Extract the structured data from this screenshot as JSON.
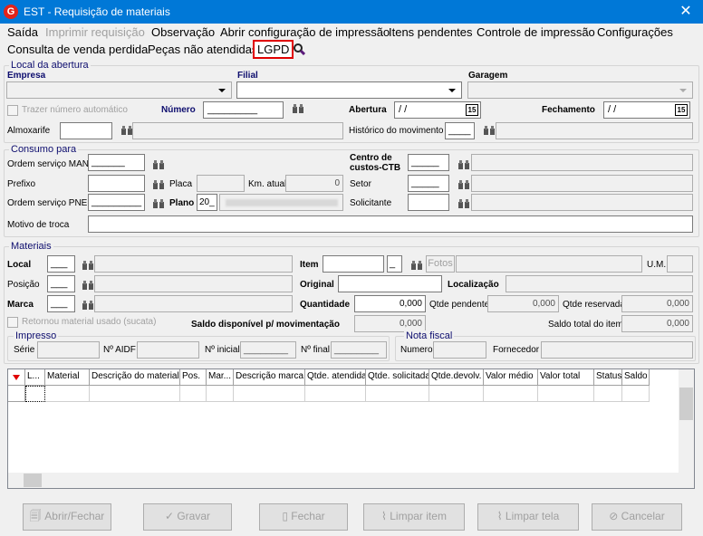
{
  "window": {
    "title": "EST - Requisição de materiais",
    "close": "✕",
    "logo": "G"
  },
  "menu": {
    "saida": "Saída",
    "imprimir": "Imprimir requisição",
    "observacao": "Observação",
    "abrir_config": "Abrir configuração de impressão",
    "itens_pendentes": "Itens pendentes",
    "controle": "Controle de impressão",
    "configuracoes": "Configurações",
    "consulta": "Consulta de venda perdida",
    "pecas": "Peças não atendidas",
    "lgpd": "LGPD"
  },
  "local": {
    "group": "Local da abertura",
    "empresa": "Empresa",
    "filial": "Filial",
    "garagem": "Garagem",
    "trazer": "Trazer número automático",
    "numero": "Número",
    "numero_value": "_________",
    "abertura": "Abertura",
    "abertura_value": "/ /",
    "fechamento": "Fechamento",
    "fechamento_value": "/ /",
    "cal": "15",
    "almoxarife": "Almoxarife",
    "historico": "Histórico do movimento",
    "historico_value": "____"
  },
  "consumo": {
    "group": "Consumo para",
    "os_man": "Ordem serviço MAN",
    "os_man_value": "______",
    "centro": "Centro de custos-CTB",
    "centro_value": "_____",
    "prefixo": "Prefixo",
    "placa": "Placa",
    "km": "Km. atual",
    "km_value": "0",
    "setor": "Setor",
    "setor_value": "_____",
    "os_pne": "Ordem serviço PNE",
    "os_pne_value": "_________",
    "plano": "Plano",
    "plano_value": "20_",
    "solicitante": "Solicitante",
    "motivo": "Motivo de troca"
  },
  "materiais": {
    "group": "Materiais",
    "local": "Local",
    "local_value": "___",
    "item": "Item",
    "item_suffix": "_",
    "fotos": "Fotos",
    "um": "U.M.",
    "posicao": "Posição",
    "posicao_value": "___",
    "original": "Original",
    "localizacao": "Localização",
    "marca": "Marca",
    "marca_value": "___",
    "quantidade": "Quantidade",
    "quantidade_value": "0,000",
    "qtde_pendente": "Qtde pendente",
    "qtde_pendente_value": "0,000",
    "qtde_reservada": "Qtde reservada",
    "qtde_reservada_value": "0,000",
    "retornou": "Retornou material usado (sucata)",
    "saldo_disp": "Saldo disponível p/ movimentação",
    "saldo_disp_value": "0,000",
    "saldo_total": "Saldo total do item",
    "saldo_total_value": "0,000"
  },
  "impresso": {
    "group": "Impresso",
    "serie": "Série",
    "aidf": "Nº AIDF",
    "inicial": "Nº inicial",
    "inicial_value": "________",
    "final": "Nº final",
    "final_value": "________"
  },
  "nota": {
    "group": "Nota fiscal",
    "numero": "Numero",
    "fornecedor": "Fornecedor"
  },
  "grid": {
    "columns": [
      "L...",
      "Material",
      "Descrição do material",
      "Pos.",
      "Mar...",
      "Descrição marca",
      "Qtde. atendida",
      "Qtde. solicitada",
      "Qtde.devolv.",
      "Valor médio",
      "Valor total",
      "Status",
      "Saldo"
    ]
  },
  "buttons": {
    "abrir_fechar": "Abrir/Fechar",
    "gravar": "Gravar",
    "fechar": "Fechar",
    "limpar_item": "Limpar item",
    "limpar_tela": "Limpar tela",
    "cancelar": "Cancelar"
  }
}
